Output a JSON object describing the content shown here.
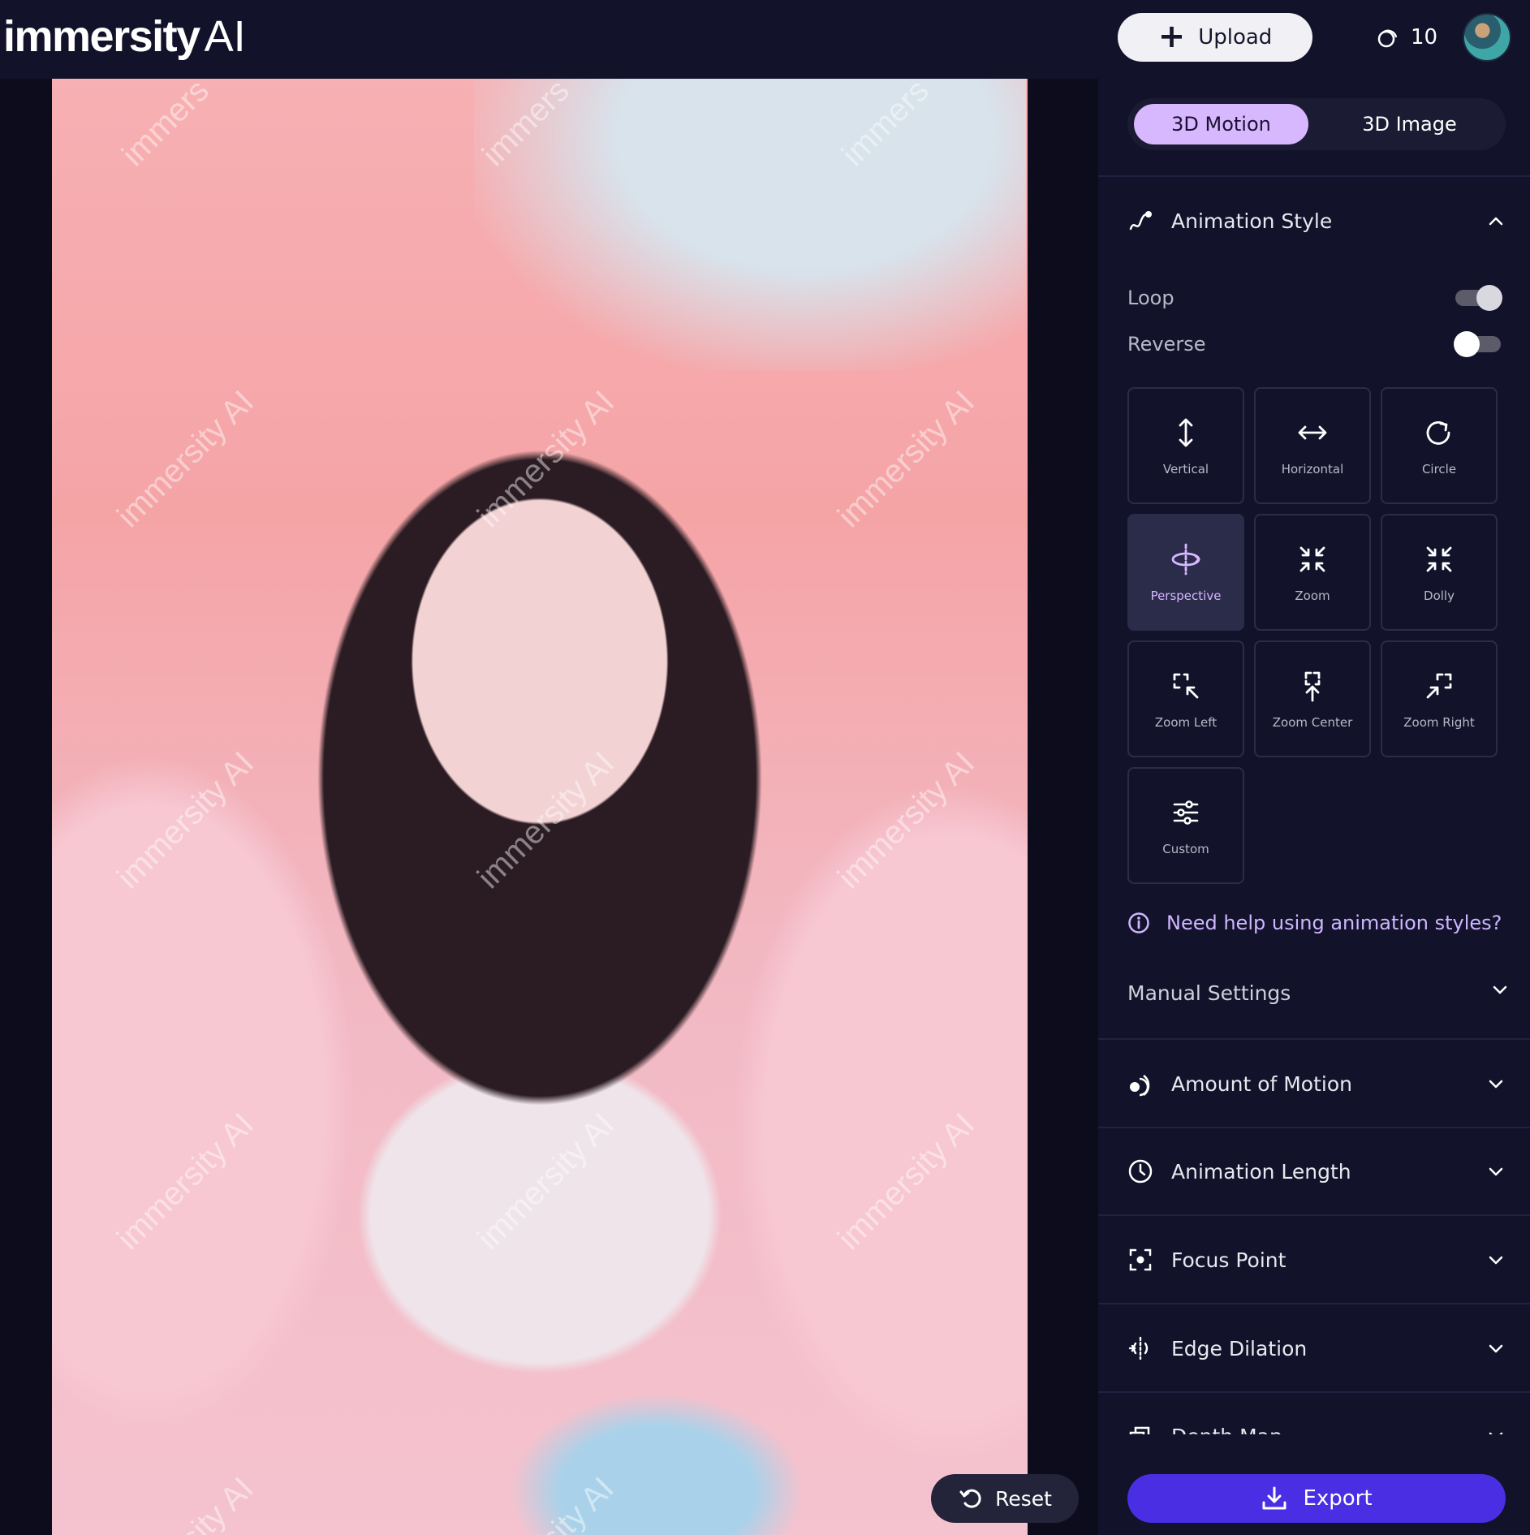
{
  "header": {
    "logo_main": "immersity",
    "logo_suffix": "AI",
    "upload_label": "Upload",
    "credits": "10"
  },
  "image": {
    "watermark": "immersity AI",
    "watermark_partial_top": "immers",
    "watermark_partial_bottom": "sity AI"
  },
  "actions": {
    "reset_label": "Reset",
    "export_label": "Export"
  },
  "panel": {
    "tabs": [
      {
        "label": "3D Motion",
        "active": true
      },
      {
        "label": "3D Image",
        "active": false
      }
    ],
    "animation_style": {
      "title": "Animation Style",
      "loop_label": "Loop",
      "loop_on": true,
      "reverse_label": "Reverse",
      "reverse_on": false,
      "styles": [
        {
          "label": "Vertical",
          "icon": "vertical-arrows-icon"
        },
        {
          "label": "Horizontal",
          "icon": "horizontal-arrows-icon"
        },
        {
          "label": "Circle",
          "icon": "circle-arrow-icon"
        },
        {
          "label": "Perspective",
          "icon": "perspective-icon",
          "selected": true
        },
        {
          "label": "Zoom",
          "icon": "zoom-icon"
        },
        {
          "label": "Dolly",
          "icon": "dolly-icon"
        },
        {
          "label": "Zoom Left",
          "icon": "zoom-left-icon"
        },
        {
          "label": "Zoom Center",
          "icon": "zoom-center-icon"
        },
        {
          "label": "Zoom Right",
          "icon": "zoom-right-icon"
        },
        {
          "label": "Custom",
          "icon": "sliders-icon"
        }
      ],
      "help_link": "Need help using animation styles?",
      "manual_settings": "Manual Settings"
    },
    "sections": [
      {
        "label": "Amount of Motion",
        "icon": "motion-icon"
      },
      {
        "label": "Animation Length",
        "icon": "clock-icon"
      },
      {
        "label": "Focus Point",
        "icon": "focus-icon"
      },
      {
        "label": "Edge Dilation",
        "icon": "edge-dilation-icon"
      },
      {
        "label": "Depth Map",
        "icon": "depth-map-icon"
      }
    ]
  },
  "colors": {
    "accent_purple": "#d7b8ff",
    "export_blue": "#4a2ee3",
    "panel_bg": "#12122a"
  }
}
